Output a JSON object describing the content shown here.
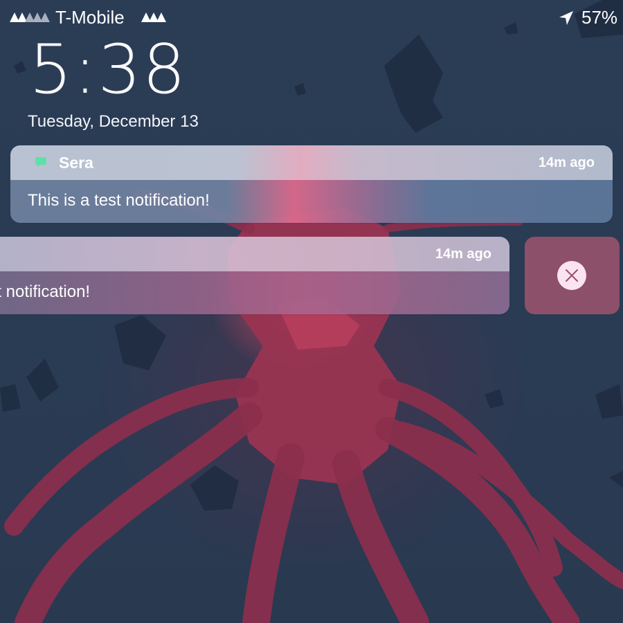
{
  "status_bar": {
    "carrier": "T-Mobile",
    "battery": "57%",
    "icons": [
      "signal-strength-icon",
      "secondary-signal-icon",
      "location-arrow-icon"
    ]
  },
  "lock_screen": {
    "time": "5:38",
    "date": "Tuesday, December 13"
  },
  "notifications": [
    {
      "app_name": "Sera",
      "app_icon": "message-bubble-icon",
      "time_ago": "14m ago",
      "message": "This is a test notification!"
    },
    {
      "time_ago": "14m ago",
      "message": "est notification!"
    }
  ],
  "actions": {
    "clear_icon": "close-icon"
  },
  "colors": {
    "app_icon": "#5fe0a8",
    "clear_tile": "#96526c",
    "clear_button": "#fbe3f1",
    "clear_glyph": "#96526c"
  }
}
